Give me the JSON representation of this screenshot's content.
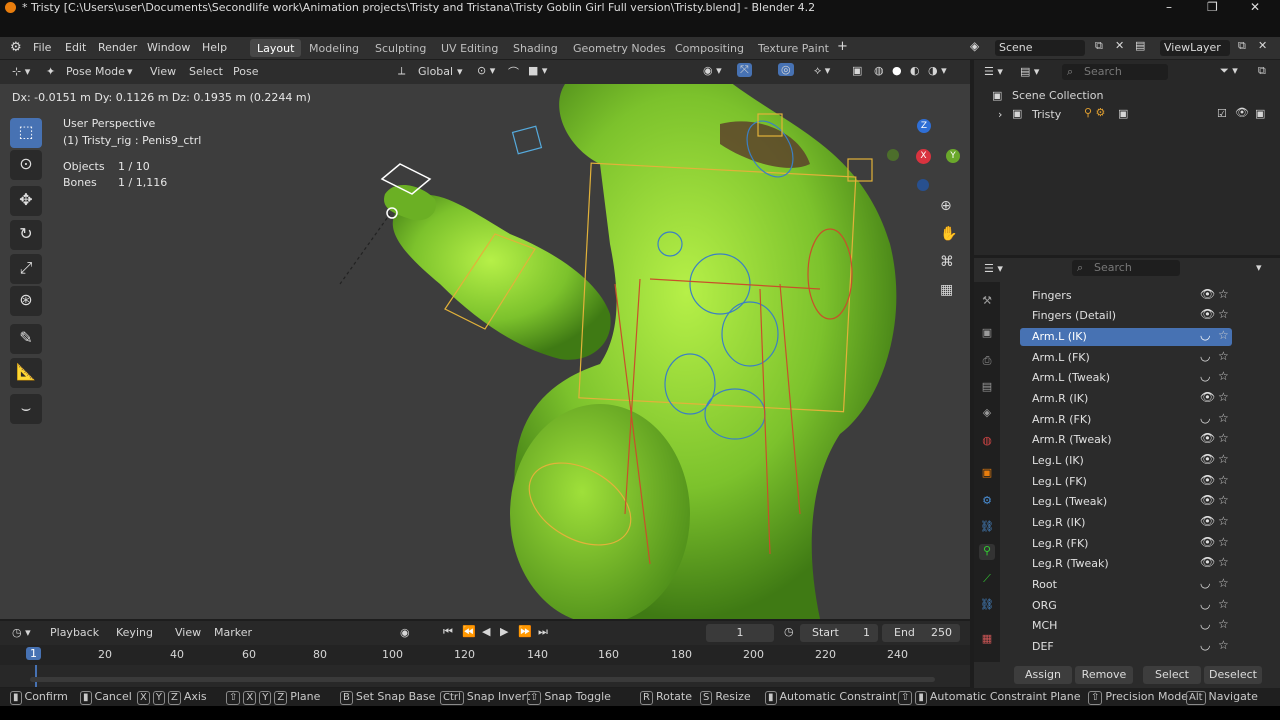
{
  "window": {
    "title": "* Tristy [C:\\Users\\user\\Documents\\Secondlife work\\Animation projects\\Tristy and Tristana\\Tristy Goblin Girl Full version\\Tristy.blend] - Blender 4.2",
    "minimize": "–",
    "maximize": "❐",
    "close": "✕"
  },
  "menu": {
    "items": [
      "File",
      "Edit",
      "Render",
      "Window",
      "Help"
    ],
    "workspaces": [
      "Layout",
      "Modeling",
      "Sculpting",
      "UV Editing",
      "Shading",
      "Geometry Nodes",
      "Compositing",
      "Texture Paint"
    ],
    "add_workspace": "+",
    "scene_label": "Scene",
    "viewlayer_label": "ViewLayer"
  },
  "header3d": {
    "mode": "Pose Mode",
    "view": "View",
    "select": "Select",
    "pose": "Pose",
    "orientation": "Global"
  },
  "viewport": {
    "delta_readout": "Dx: -0.0151 m   Dy: 0.1126 m   Dz: 0.1935 m (0.2244 m)",
    "perspective": "User Perspective",
    "active": "(1) Tristy_rig : Penis9_ctrl",
    "objects_label": "Objects",
    "objects_value": "1 / 10",
    "bones_label": "Bones",
    "bones_value": "1 / 1,116",
    "gizmo_z": "Z",
    "gizmo_x": "X",
    "gizmo_y": "Y"
  },
  "outliner": {
    "search_placeholder": "Search",
    "collection": "Scene Collection",
    "object": "Tristy"
  },
  "props": {
    "search_placeholder": "Search",
    "collections": [
      {
        "label": "Fingers",
        "visible": true
      },
      {
        "label": "Fingers (Detail)",
        "visible": true
      },
      {
        "label": "Arm.L (IK)",
        "visible": false,
        "selected": true
      },
      {
        "label": "Arm.L (FK)",
        "visible": false
      },
      {
        "label": "Arm.L (Tweak)",
        "visible": false
      },
      {
        "label": "Arm.R (IK)",
        "visible": true
      },
      {
        "label": "Arm.R (FK)",
        "visible": false
      },
      {
        "label": "Arm.R (Tweak)",
        "visible": true
      },
      {
        "label": "Leg.L (IK)",
        "visible": true
      },
      {
        "label": "Leg.L (FK)",
        "visible": true
      },
      {
        "label": "Leg.L (Tweak)",
        "visible": true
      },
      {
        "label": "Leg.R (IK)",
        "visible": true
      },
      {
        "label": "Leg.R (FK)",
        "visible": true
      },
      {
        "label": "Leg.R (Tweak)",
        "visible": true
      },
      {
        "label": "Root",
        "visible": false
      },
      {
        "label": "ORG",
        "visible": false
      },
      {
        "label": "MCH",
        "visible": false
      },
      {
        "label": "DEF",
        "visible": false
      }
    ],
    "assign": "Assign",
    "remove": "Remove",
    "select": "Select",
    "deselect": "Deselect"
  },
  "timeline": {
    "playback": "Playback",
    "keying": "Keying",
    "view": "View",
    "marker": "Marker",
    "current_frame": "1",
    "start_label": "Start",
    "start_value": "1",
    "end_label": "End",
    "end_value": "250",
    "playhead": "1",
    "ticks": [
      "20",
      "40",
      "60",
      "80",
      "100",
      "120",
      "140",
      "160",
      "180",
      "200",
      "220",
      "240"
    ]
  },
  "status": {
    "confirm": "Confirm",
    "cancel": "Cancel",
    "axis_keys": [
      "X",
      "Y",
      "Z"
    ],
    "axis": "Axis",
    "plane_keys": [
      "X",
      "Y",
      "Z"
    ],
    "plane": "Plane",
    "snap_base_key": "B",
    "snap_base": "Set Snap Base",
    "snap_invert_key": "Ctrl",
    "snap_invert": "Snap Invert",
    "snap_toggle": "Snap Toggle",
    "rotate_key": "R",
    "rotate": "Rotate",
    "resize_key": "S",
    "resize": "Resize",
    "auto_constraint": "Automatic Constraint",
    "auto_constraint_plane": "Automatic Constraint Plane",
    "precision": "Precision Mode",
    "navigate_key": "Alt",
    "navigate": "Navigate"
  },
  "colors": {
    "accent": "#4772b3",
    "model_green": "#7cc22c",
    "bone_yellow": "#e2b23a",
    "bone_red": "#c8502a",
    "bone_blue": "#3b7fc4"
  }
}
